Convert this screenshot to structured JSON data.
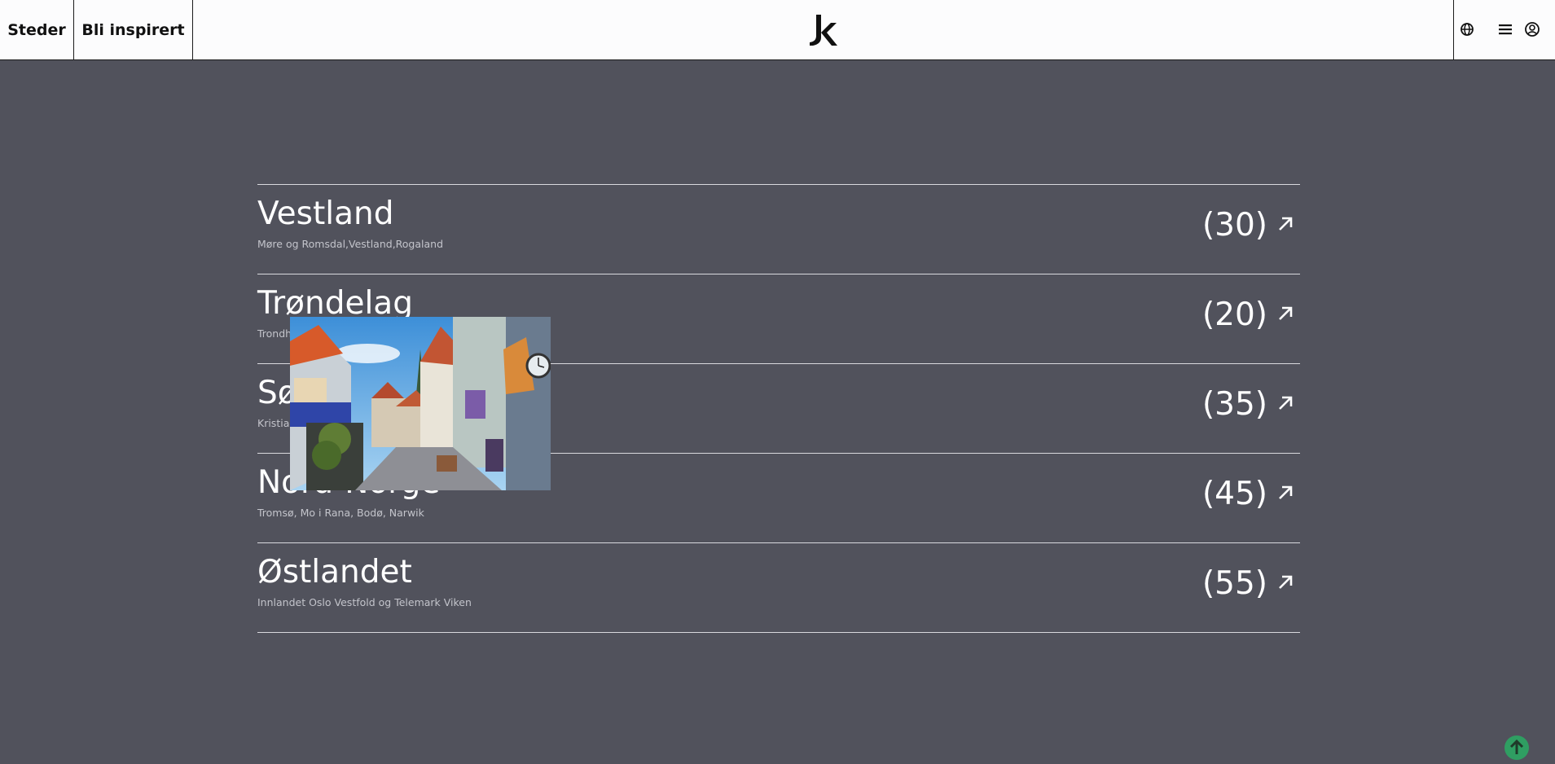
{
  "nav": {
    "steder": "Steder",
    "bli_inspirert": "Bli inspirert",
    "logo_icon": "k-logo-icon"
  },
  "tools": [
    "globe-icon",
    "menu-icon",
    "user-icon"
  ],
  "regions": [
    {
      "title": "Vestland",
      "subtitle": "Møre og Romsdal,Vestland,Rogaland",
      "count": "(30)"
    },
    {
      "title": "Trøndelag",
      "subtitle": "Trondh",
      "count": "(20)"
    },
    {
      "title": "Sø",
      "subtitle": "Kristian",
      "count": "(35)"
    },
    {
      "title": "Nord-Norge",
      "subtitle": "Tromsø, Mo i Rana, Bodø, Narwik",
      "count": "(45)"
    },
    {
      "title": "Østlandet",
      "subtitle": "Innlandet Oslo Vestfold og Telemark Viken",
      "count": "(55)"
    }
  ],
  "colors": {
    "background": "#51525c",
    "topbar": "#fcfcfd",
    "scroll_top_button": "#2f9e62"
  }
}
